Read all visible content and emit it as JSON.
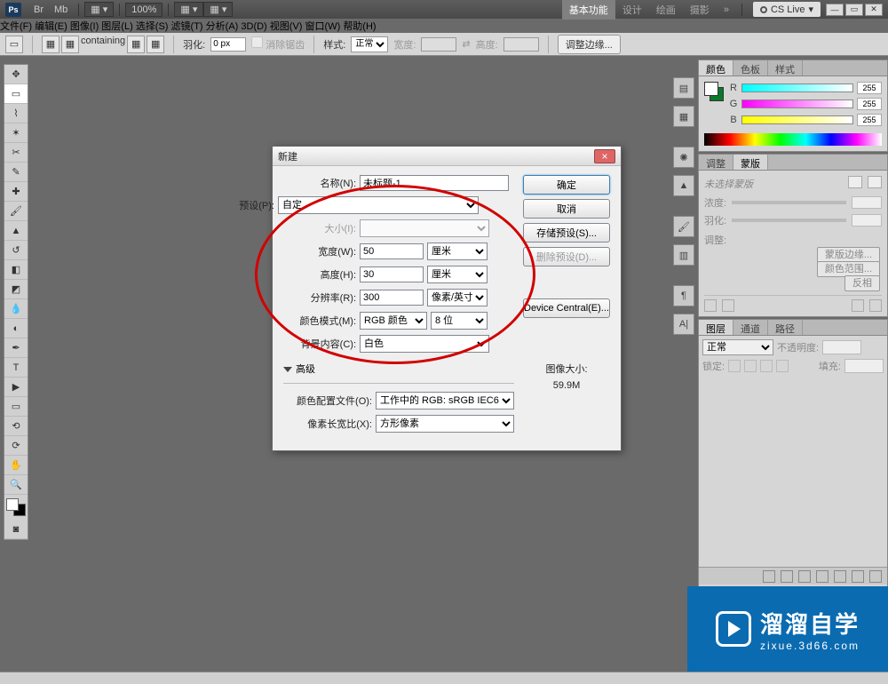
{
  "topbar": {
    "app_abbr": "Ps",
    "icons": [
      "Br",
      "Mb"
    ],
    "zoom": "100%",
    "tabs": {
      "active": "基本功能",
      "others": [
        "设计",
        "绘画",
        "摄影"
      ]
    },
    "cslive": "CS Live"
  },
  "menu": [
    "文件(F)",
    "编辑(E)",
    "图像(I)",
    "图层(L)",
    "选择(S)",
    "滤镜(T)",
    "分析(A)",
    "3D(D)",
    "视图(V)",
    "窗口(W)",
    "帮助(H)"
  ],
  "optbar": {
    "feather_label": "羽化:",
    "feather_value": "0 px",
    "antialias": "消除锯齿",
    "style_label": "样式:",
    "style_value": "正常",
    "width_label": "宽度:",
    "height_label": "高度:",
    "refine_edge": "调整边缘..."
  },
  "right": {
    "color": {
      "tabs": [
        "颜色",
        "色板",
        "样式"
      ],
      "r_label": "R",
      "g_label": "G",
      "b_label": "B",
      "r": "255",
      "g": "255",
      "b": "255"
    },
    "adjmask": {
      "tabs": [
        "调整",
        "蒙版"
      ],
      "no_sel": "未选择蒙版",
      "density_label": "浓度:",
      "feather_label": "羽化:",
      "adjust_label": "调整:",
      "btn1": "蒙版边缘...",
      "btn2": "颜色范围...",
      "btn3": "反相"
    },
    "layers": {
      "tabs": [
        "图层",
        "通道",
        "路径"
      ],
      "blend": "正常",
      "opacity_label": "不透明度:",
      "lock_label": "锁定:",
      "fill_label": "填充:"
    }
  },
  "dialog": {
    "title": "新建",
    "name_label": "名称(N):",
    "name_value": "未标题-1",
    "preset_label": "预设(P):",
    "preset_value": "自定",
    "size_label": "大小(I):",
    "width_label": "宽度(W):",
    "width_value": "50",
    "width_unit": "厘米",
    "height_label": "高度(H):",
    "height_value": "30",
    "height_unit": "厘米",
    "res_label": "分辨率(R):",
    "res_value": "300",
    "res_unit": "像素/英寸",
    "mode_label": "颜色模式(M):",
    "mode_value": "RGB 颜色",
    "depth_value": "8 位",
    "bg_label": "背景内容(C):",
    "bg_value": "白色",
    "adv_label": "高级",
    "profile_label": "颜色配置文件(O):",
    "profile_value": "工作中的 RGB: sRGB IEC6...",
    "par_label": "像素长宽比(X):",
    "par_value": "方形像素",
    "ok": "确定",
    "cancel": "取消",
    "save_preset": "存储预设(S)...",
    "delete_preset": "删除预设(D)...",
    "device_central": "Device Central(E)...",
    "image_size_label": "图像大小:",
    "image_size_value": "59.9M"
  },
  "watermark": {
    "brand": "溜溜自学",
    "url": "zixue.3d66.com"
  }
}
